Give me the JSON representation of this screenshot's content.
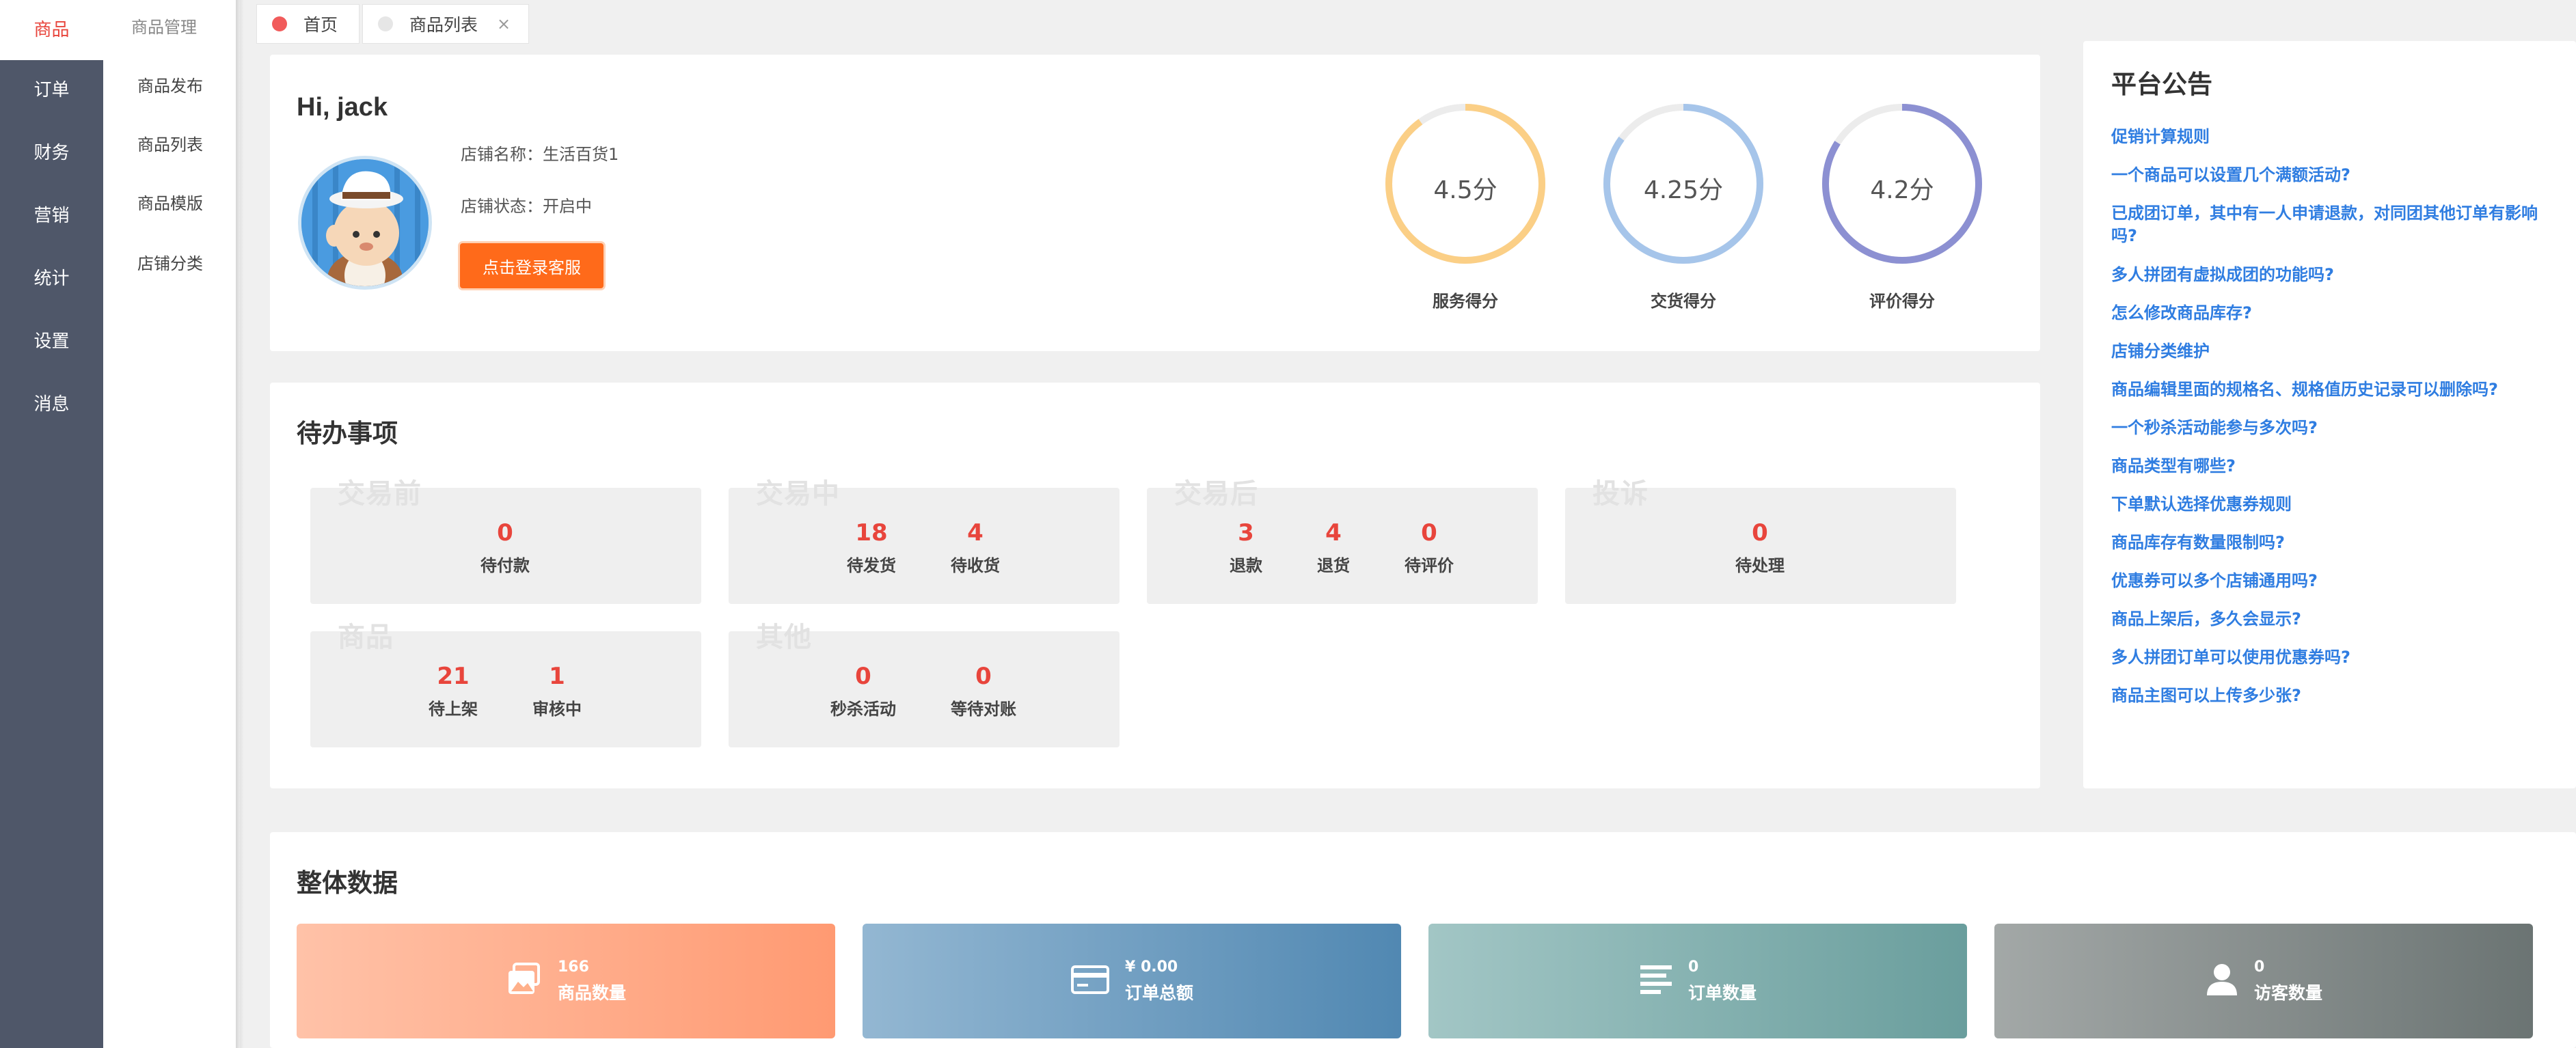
{
  "sidebar": {
    "items": [
      {
        "label": "商品",
        "active": true
      },
      {
        "label": "订单"
      },
      {
        "label": "财务"
      },
      {
        "label": "营销"
      },
      {
        "label": "统计"
      },
      {
        "label": "设置"
      },
      {
        "label": "消息"
      }
    ]
  },
  "subnav": {
    "title": "商品管理",
    "items": [
      "商品发布",
      "商品列表",
      "商品模版",
      "店铺分类"
    ]
  },
  "tabs": [
    {
      "label": "首页",
      "dot_color": "#f15b5b"
    },
    {
      "label": "商品列表",
      "dot_color": "#e6e6e6",
      "close": "×"
    }
  ],
  "profile": {
    "greeting": "Hi, jack",
    "shop_name": "店铺名称：生活百货1",
    "shop_status": "店铺状态：开启中",
    "login_button": "点击登录客服"
  },
  "scores": [
    {
      "value": "4.5分",
      "label": "服务得分",
      "ratio": 0.9,
      "color": "#fbcf86"
    },
    {
      "value": "4.25分",
      "label": "交货得分",
      "ratio": 0.85,
      "color": "#a6c5ea"
    },
    {
      "value": "4.2分",
      "label": "评价得分",
      "ratio": 0.84,
      "color": "#8c90d2"
    }
  ],
  "todo": {
    "title": "待办事项",
    "groups": [
      {
        "name": "交易前",
        "items": [
          {
            "num": "0",
            "label": "待付款"
          }
        ]
      },
      {
        "name": "交易中",
        "items": [
          {
            "num": "18",
            "label": "待发货"
          },
          {
            "num": "4",
            "label": "待收货"
          }
        ]
      },
      {
        "name": "交易后",
        "items": [
          {
            "num": "3",
            "label": "退款"
          },
          {
            "num": "4",
            "label": "退货"
          },
          {
            "num": "0",
            "label": "待评价"
          }
        ]
      },
      {
        "name": "投诉",
        "items": [
          {
            "num": "0",
            "label": "待处理"
          }
        ]
      },
      {
        "name": "商品",
        "items": [
          {
            "num": "21",
            "label": "待上架"
          },
          {
            "num": "1",
            "label": "审核中"
          }
        ]
      },
      {
        "name": "其他",
        "items": [
          {
            "num": "0",
            "label": "秒杀活动"
          },
          {
            "num": "0",
            "label": "等待对账"
          }
        ]
      }
    ]
  },
  "notice": {
    "title": "平台公告",
    "items": [
      "促销计算规则",
      "一个商品可以设置几个满额活动?",
      "已成团订单，其中有一人申请退款，对同团其他订单有影响吗?",
      "多人拼团有虚拟成团的功能吗?",
      "怎么修改商品库存?",
      "店铺分类维护",
      "商品编辑里面的规格名、规格值历史记录可以删除吗?",
      "一个秒杀活动能参与多次吗?",
      "商品类型有哪些?",
      "下单默认选择优惠券规则",
      "商品库存有数量限制吗?",
      "优惠券可以多个店铺通用吗?",
      "商品上架后，多久会显示?",
      "多人拼团订单可以使用优惠券吗?",
      "商品主图可以上传多少张?"
    ]
  },
  "overview": {
    "title": "整体数据",
    "cards": [
      {
        "value": "166",
        "label": "商品数量",
        "icon": "images-icon",
        "from": "#ffc2a8",
        "to": "#ff9a72"
      },
      {
        "value": "¥ 0.00",
        "label": "订单总额",
        "icon": "credit-card-icon",
        "from": "#93b7d2",
        "to": "#5188b2"
      },
      {
        "value": "0",
        "label": "订单数量",
        "icon": "list-icon",
        "from": "#a2c6c5",
        "to": "#6a9e9d"
      },
      {
        "value": "0",
        "label": "访客数量",
        "icon": "user-icon",
        "from": "#a3a8a7",
        "to": "#6b7473"
      }
    ]
  }
}
